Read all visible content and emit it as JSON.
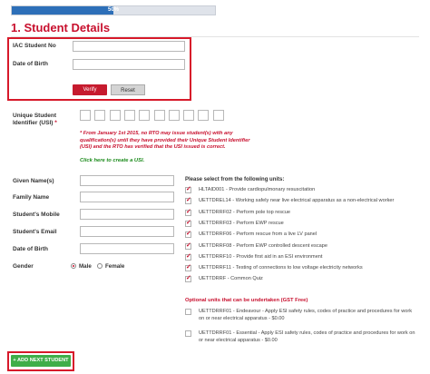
{
  "progress": {
    "label": "50%",
    "value": 0.5,
    "color": "#2d6fb8"
  },
  "section_title": "1. Student Details",
  "verify": {
    "iac_label": "IAC Student No",
    "dob_label": "Date of Birth",
    "verify_button": "Verify",
    "reset_button": "Reset"
  },
  "usi": {
    "label_line1": "Unique Student",
    "label_line2": "Identifier (USI)",
    "required_mark": "*",
    "box_count": 10,
    "note": "* From January 1st 2015, no RTO may issue student(s) with any qualification(s) until they have provided their Unique Student Identifier (USI) and the RTO has verified that the USI issued is correct.",
    "link": "Click here to create a USI."
  },
  "fields": {
    "given_names": "Given Name(s)",
    "family_name": "Family Name",
    "mobile": "Student's Mobile",
    "email": "Student's Email",
    "dob": "Date of Birth",
    "gender": "Gender",
    "male": "Male",
    "female": "Female",
    "gender_selected": "Male"
  },
  "units_title": "Please select from the following units:",
  "units": [
    {
      "label": "HLTAID001 - Provide cardiopulmonary resuscitation",
      "checked": true
    },
    {
      "label": "UETTDREL14 - Working safely near live electrical apparatus as a non-electrical worker",
      "checked": true
    },
    {
      "label": "UETTDRRF02 - Perform pole top rescue",
      "checked": true
    },
    {
      "label": "UETTDRRF03 - Perform EWP rescue",
      "checked": true
    },
    {
      "label": "UETTDRRF06 - Perform rescue from a live LV panel",
      "checked": true
    },
    {
      "label": "UETTDRRF08 - Perform EWP controlled descent escape",
      "checked": true
    },
    {
      "label": "UETTDRRF10 - Provide first aid in an ESI environment",
      "checked": true
    },
    {
      "label": "UETTDRRF11 - Testing of connections to low voltage electricity networks",
      "checked": true
    },
    {
      "label": "UETTDRRF - Common Quiz",
      "checked": true
    }
  ],
  "optional_title": "Optional units that can be undertaken (GST Free)",
  "optional_units": [
    {
      "label": "UETTDRRF01 - Endeavour - Apply ESI safety rules, codes of practice and procedures for work on or near electrical apparatus - $0.00",
      "checked": false
    },
    {
      "label": "UETTDRRF01 - Essential - Apply ESI safety rules, codes of practice and procedures for work on or near electrical apparatus - $0.00",
      "checked": false
    }
  ],
  "add_next_student": "+ ADD NEXT STUDENT",
  "colors": {
    "accent": "#c8102e",
    "highlight_border": "#d7192a",
    "add_button": "#3fae49",
    "link": "#1a8a1a"
  }
}
